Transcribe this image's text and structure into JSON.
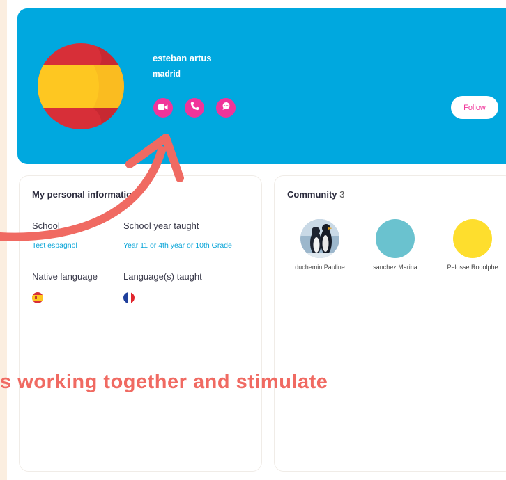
{
  "profile": {
    "name": "esteban artus",
    "city": "madrid",
    "follow_label": "Follow",
    "actions": [
      {
        "icon": "video-camera-icon"
      },
      {
        "icon": "phone-icon"
      },
      {
        "icon": "chat-bubble-icon"
      }
    ]
  },
  "personal": {
    "title": "My personal information",
    "school_label": "School",
    "school_value": "Test espagnol",
    "year_label": "School year taught",
    "year_value": "Year 11 or 4th year or 10th Grade",
    "native_label": "Native language",
    "taught_label": "Language(s) taught"
  },
  "community": {
    "title": "Community",
    "count": "3",
    "members": [
      {
        "name": "duchemin Pauline",
        "avatar": "penguin-photo"
      },
      {
        "name": "sanchez Marina",
        "avatar_color": "#6ac2cf"
      },
      {
        "name": "Pelosse Rodolphe",
        "avatar_color": "#fede2d"
      }
    ]
  },
  "overlay": {
    "caption": "s working together and stimulate"
  },
  "colors": {
    "banner": "#00a8df",
    "accent_pink": "#f0349a",
    "link_blue": "#0aa5d8",
    "caption_coral": "#f06a62"
  }
}
